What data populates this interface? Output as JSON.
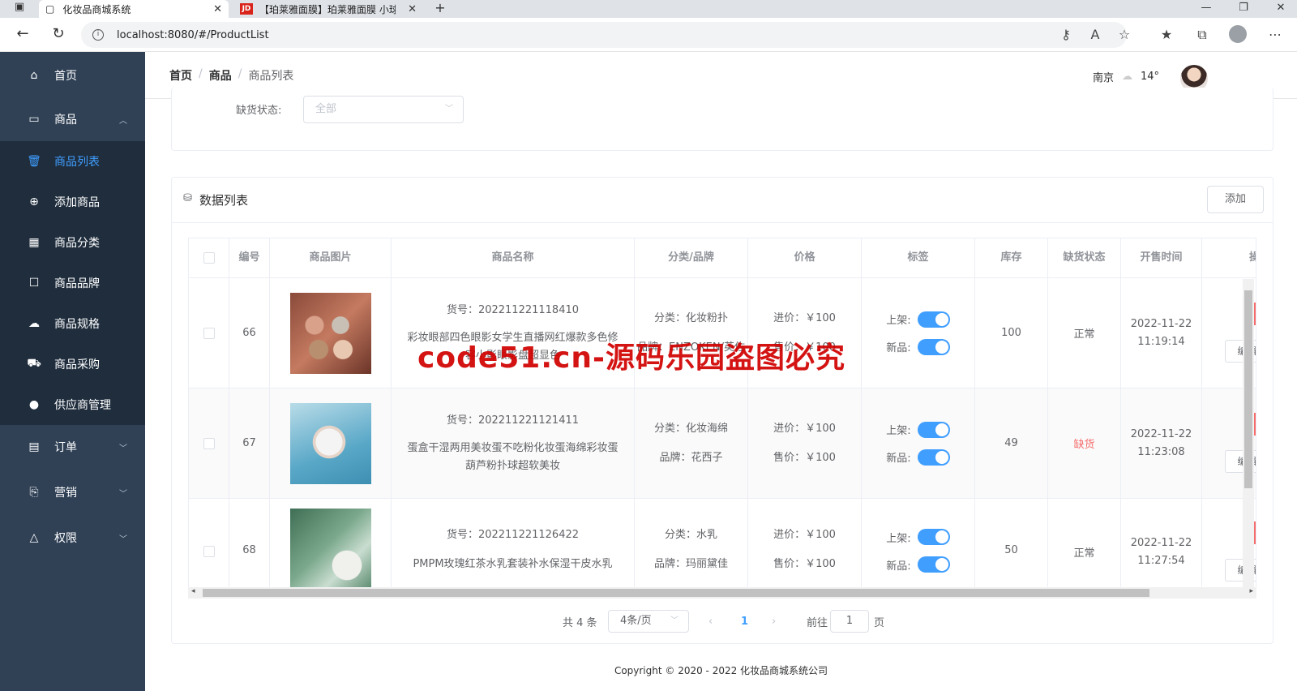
{
  "browser": {
    "tabs": [
      {
        "title": "化妆品商城系统"
      },
      {
        "title": "【珀莱雅面膜】珀莱雅面膜 小球"
      }
    ],
    "jd_logo": "JD",
    "url": "localhost:8080/#/ProductList"
  },
  "sidebar": {
    "items": [
      {
        "label": "首页",
        "icon": "home-icon"
      },
      {
        "label": "商品",
        "icon": "bag-icon"
      },
      {
        "label": "商品列表",
        "icon": "trash-icon"
      },
      {
        "label": "添加商品",
        "icon": "plus-circle-icon"
      },
      {
        "label": "商品分类",
        "icon": "grid-icon"
      },
      {
        "label": "商品品牌",
        "icon": "badge-icon"
      },
      {
        "label": "商品规格",
        "icon": "cloud-icon"
      },
      {
        "label": "商品采购",
        "icon": "truck-icon"
      },
      {
        "label": "供应商管理",
        "icon": "user-icon"
      },
      {
        "label": "订单",
        "icon": "document-icon"
      },
      {
        "label": "营销",
        "icon": "bag-share-icon"
      },
      {
        "label": "权限",
        "icon": "bell-icon"
      }
    ]
  },
  "header": {
    "breadcrumb": [
      "首页",
      "商品",
      "商品列表"
    ],
    "city": "南京",
    "temperature": "14°"
  },
  "filter": {
    "stock_label": "缺货状态:",
    "stock_placeholder": "全部"
  },
  "list": {
    "title": "数据列表",
    "add_button": "添加",
    "columns": [
      "编号",
      "商品图片",
      "商品名称",
      "分类/品牌",
      "价格",
      "标签",
      "库存",
      "缺货状态",
      "开售时间",
      "操"
    ],
    "rows": [
      {
        "id": "66",
        "sku": "货号：202211221118410",
        "name": "彩妆眼部四色眼影女学生直播网红爆款多色修容小影眼影盘超显色",
        "category": "分类：化妆粉扑",
        "brand": "品牌：ENZOKEN/英佐",
        "cost": "进价：￥100",
        "price": "售价：￥100",
        "on_shelf": "上架:",
        "new_item": "新品:",
        "stock": "100",
        "status": "正常",
        "date": "2022-11-22",
        "time": "11:19:14",
        "edit": "编辑"
      },
      {
        "id": "67",
        "sku": "货号：202211221121411",
        "name": "蛋盒干湿两用美妆蛋不吃粉化妆蛋海绵彩妆蛋葫芦粉扑球超软美妆",
        "category": "分类：化妆海绵",
        "brand": "品牌：花西子",
        "cost": "进价：￥100",
        "price": "售价：￥100",
        "on_shelf": "上架:",
        "new_item": "新品:",
        "stock": "49",
        "status": "缺货",
        "date": "2022-11-22",
        "time": "11:23:08",
        "edit": "编辑"
      },
      {
        "id": "68",
        "sku": "货号：202211221126422",
        "name": "PMPM玫瑰红茶水乳套装补水保湿干皮水乳",
        "category": "分类：水乳",
        "brand": "品牌：玛丽黛佳",
        "cost": "进价：￥100",
        "price": "售价：￥100",
        "on_shelf": "上架:",
        "new_item": "新品:",
        "stock": "50",
        "status": "正常",
        "date": "2022-11-22",
        "time": "11:27:54",
        "edit": "编辑"
      }
    ]
  },
  "pagination": {
    "total": "共 4 条",
    "page_size": "4条/页",
    "current": "1",
    "goto_label": "前往",
    "goto_value": "1",
    "page_suffix": "页"
  },
  "footer": "Copyright © 2020 - 2022   化妆品商城系统公司",
  "watermark": "code51.cn-源码乐园盗图必究",
  "colors": {
    "sidebar": "#304156",
    "accent": "#409eff",
    "danger": "#f56c6c"
  }
}
